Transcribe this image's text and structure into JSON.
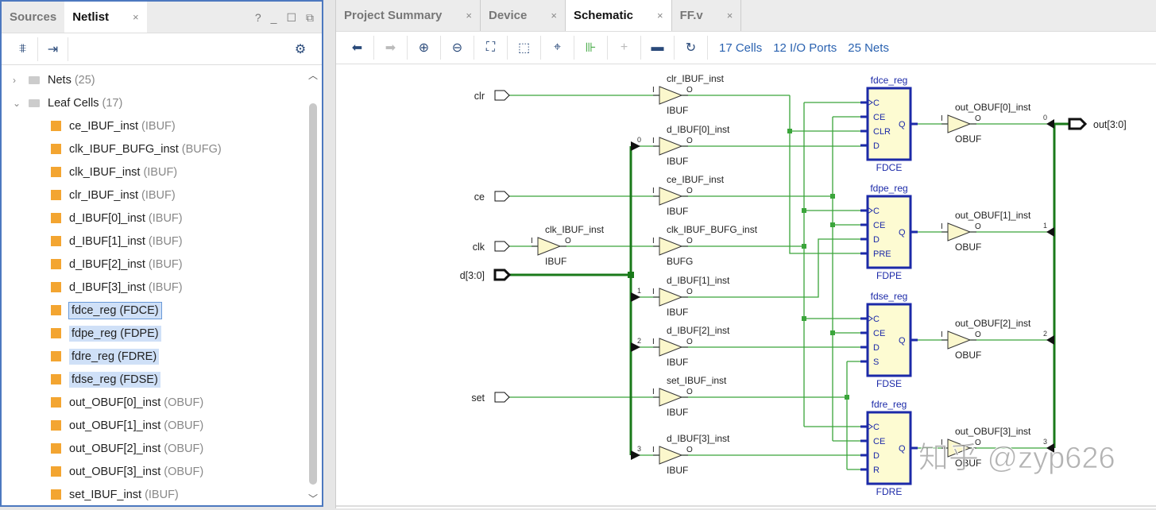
{
  "left_panel": {
    "tabs": [
      {
        "label": "Sources",
        "active": false
      },
      {
        "label": "Netlist",
        "active": true
      }
    ],
    "close": "×",
    "help": "?",
    "minimize": "_",
    "maximize": "☐",
    "float": "⧉",
    "toolbar": [
      "collapse-all-icon",
      "expand-icon",
      "gear-icon"
    ],
    "tree": {
      "nets": {
        "label": "Nets",
        "count": "(25)"
      },
      "leaf_cells": {
        "label": "Leaf Cells",
        "count": "(17)"
      },
      "cells": [
        {
          "name": "ce_IBUF_inst",
          "type": "(IBUF)"
        },
        {
          "name": "clk_IBUF_BUFG_inst",
          "type": "(BUFG)"
        },
        {
          "name": "clk_IBUF_inst",
          "type": "(IBUF)"
        },
        {
          "name": "clr_IBUF_inst",
          "type": "(IBUF)"
        },
        {
          "name": "d_IBUF[0]_inst",
          "type": "(IBUF)"
        },
        {
          "name": "d_IBUF[1]_inst",
          "type": "(IBUF)"
        },
        {
          "name": "d_IBUF[2]_inst",
          "type": "(IBUF)"
        },
        {
          "name": "d_IBUF[3]_inst",
          "type": "(IBUF)"
        },
        {
          "name": "fdce_reg (FDCE)",
          "type": "",
          "selected": true,
          "focused": true
        },
        {
          "name": "fdpe_reg (FDPE)",
          "type": "",
          "selected": true
        },
        {
          "name": "fdre_reg (FDRE)",
          "type": "",
          "selected": true
        },
        {
          "name": "fdse_reg (FDSE)",
          "type": "",
          "selected": true
        },
        {
          "name": "out_OBUF[0]_inst",
          "type": "(OBUF)"
        },
        {
          "name": "out_OBUF[1]_inst",
          "type": "(OBUF)"
        },
        {
          "name": "out_OBUF[2]_inst",
          "type": "(OBUF)"
        },
        {
          "name": "out_OBUF[3]_inst",
          "type": "(OBUF)"
        },
        {
          "name": "set_IBUF_inst",
          "type": "(IBUF)"
        }
      ]
    }
  },
  "right_panel": {
    "tabs": [
      {
        "label": "Project Summary"
      },
      {
        "label": "Device"
      },
      {
        "label": "Schematic",
        "active": true
      },
      {
        "label": "FF.v"
      }
    ],
    "close": "×",
    "toolbar": [
      "back-icon",
      "forward-icon",
      "zoom-in-icon",
      "zoom-out-icon",
      "fit-icon",
      "zoom-select-icon",
      "center-icon",
      "cell-icon",
      "expand-plus-icon",
      "collapse-minus-icon",
      "refresh-icon"
    ],
    "stats": [
      "17 Cells",
      "12 I/O Ports",
      "25 Nets"
    ]
  },
  "schematic": {
    "colors": {
      "wire": "#3aa53a",
      "bus": "#1a7a1a",
      "reg": "#1c2aa8",
      "buf_fill": "#fbf7cc",
      "reg_fill": "#fdfbd2"
    },
    "inputs": [
      "clr",
      "ce",
      "clk",
      "d[3:0]",
      "set"
    ],
    "output": "out[3:0]",
    "buffers": [
      {
        "name": "clr_IBUF_inst",
        "type": "IBUF"
      },
      {
        "name": "d_IBUF[0]_inst",
        "type": "IBUF",
        "bit": "0"
      },
      {
        "name": "ce_IBUF_inst",
        "type": "IBUF"
      },
      {
        "name": "clk_IBUF_BUFG_inst",
        "type": "BUFG"
      },
      {
        "name": "d_IBUF[1]_inst",
        "type": "IBUF",
        "bit": "1"
      },
      {
        "name": "d_IBUF[2]_inst",
        "type": "IBUF",
        "bit": "2"
      },
      {
        "name": "set_IBUF_inst",
        "type": "IBUF"
      },
      {
        "name": "d_IBUF[3]_inst",
        "type": "IBUF",
        "bit": "3"
      },
      {
        "name": "clk_IBUF_inst",
        "type": "IBUF"
      }
    ],
    "pin_i": "I",
    "pin_o": "O",
    "registers": [
      {
        "name": "fdce_reg",
        "type": "FDCE",
        "pins": [
          "C",
          "CE",
          "CLR",
          "D"
        ],
        "q": "Q"
      },
      {
        "name": "fdpe_reg",
        "type": "FDPE",
        "pins": [
          "C",
          "CE",
          "D",
          "PRE"
        ],
        "q": "Q"
      },
      {
        "name": "fdse_reg",
        "type": "FDSE",
        "pins": [
          "C",
          "CE",
          "D",
          "S"
        ],
        "q": "Q"
      },
      {
        "name": "fdre_reg",
        "type": "FDRE",
        "pins": [
          "C",
          "CE",
          "D",
          "R"
        ],
        "q": "Q"
      }
    ],
    "obufs": [
      {
        "name": "out_OBUF[0]_inst",
        "type": "OBUF",
        "bit": "0"
      },
      {
        "name": "out_OBUF[1]_inst",
        "type": "OBUF",
        "bit": "1"
      },
      {
        "name": "out_OBUF[2]_inst",
        "type": "OBUF",
        "bit": "2"
      },
      {
        "name": "out_OBUF[3]_inst",
        "type": "OBUF",
        "bit": "3"
      }
    ],
    "watermark": "知乎 @zyp626"
  }
}
